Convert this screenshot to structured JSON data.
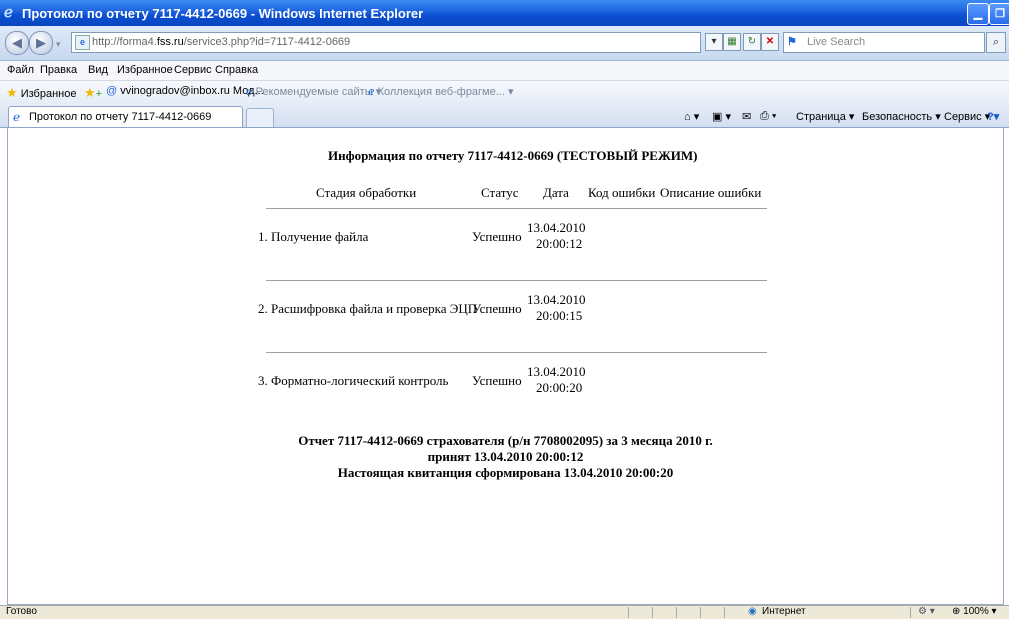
{
  "window": {
    "title": "Протокол по отчету 7117-4412-0669 - Windows Internet Explorer",
    "min_btn": "▁",
    "max_btn": "❐"
  },
  "address": {
    "url_prefix": "http://forma4.",
    "url_domain": "fss.ru",
    "url_suffix": "/service3.php?id=7117-4412-0669",
    "search_placeholder": "Live Search"
  },
  "menu": [
    "Файл",
    "Правка",
    "Вид",
    "Избранное",
    "Сервис",
    "Справка"
  ],
  "favorites": {
    "label": "Избранное",
    "item1": "vvinogradov@inbox.ru Мод...",
    "item2": "Рекомендуемые сайты ▾",
    "item3": "Коллекция веб-фрагме... ▾"
  },
  "tab": {
    "title": "Протокол по отчету 7117-4412-0669"
  },
  "commandbar": {
    "page": "Страница ▾",
    "safety": "Безопасность ▾",
    "tools": "Сервис ▾"
  },
  "report": {
    "heading": "Информация по отчету 7117-4412-0669 (ТЕСТОВЫЙ РЕЖИМ)",
    "columns": [
      "Стадия обработки",
      "Статус",
      "Дата",
      "Код ошибки",
      "Описание ошибки"
    ],
    "rows": [
      {
        "stage": "1. Получение файла",
        "status": "Успешно",
        "date": "13.04.2010",
        "time": "20:00:12"
      },
      {
        "stage": "2. Расшифровка файла и проверка ЭЦП",
        "status": "Успешно",
        "date": "13.04.2010",
        "time": "20:00:15"
      },
      {
        "stage": "3. Форматно-логический контроль",
        "status": "Успешно",
        "date": "13.04.2010",
        "time": "20:00:20"
      }
    ],
    "footer_line1": "Отчет 7117-4412-0669 страхователя (р/н 7708002095) за 3 месяца 2010 г.",
    "footer_line2": "принят 13.04.2010 20:00:12",
    "footer_line3": "Настоящая квитанция сформирована 13.04.2010 20:00:20"
  },
  "status": {
    "left": "Готово",
    "zone": "Интернет",
    "zoom": "100%"
  }
}
